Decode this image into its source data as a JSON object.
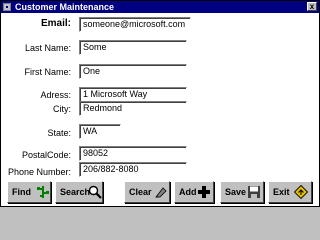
{
  "window": {
    "title": "Customer Maintenance",
    "close_label": "x"
  },
  "form": {
    "email": {
      "label": "Email:",
      "value": "someone@microsoft.com"
    },
    "last_name": {
      "label": "Last Name:",
      "value": "Some"
    },
    "first_name": {
      "label": "First Name:",
      "value": "One"
    },
    "address": {
      "label": "Adress:",
      "value": "1 Microsoft Way"
    },
    "city": {
      "label": "City:",
      "value": "Redmond"
    },
    "state": {
      "label": "State:",
      "value": "WA"
    },
    "postal": {
      "label": "PostalCode:",
      "value": "98052"
    },
    "phone": {
      "label": "Phone Number:",
      "value": "206/882-8080"
    }
  },
  "buttons": {
    "find": "Find",
    "search": "Search",
    "clear": "Clear",
    "add": "Add",
    "save": "Save",
    "exit": "Exit"
  },
  "icons": {
    "find": "tree-icon",
    "search": "magnifier-icon",
    "clear": "eraser-icon",
    "add": "plus-icon",
    "save": "floppy-disk-icon",
    "exit": "exit-sign-icon"
  },
  "colors": {
    "titlebar": "#000080",
    "face": "#c0c0c0",
    "add_plus": "#000000",
    "exit_sign": "#e8c000"
  }
}
